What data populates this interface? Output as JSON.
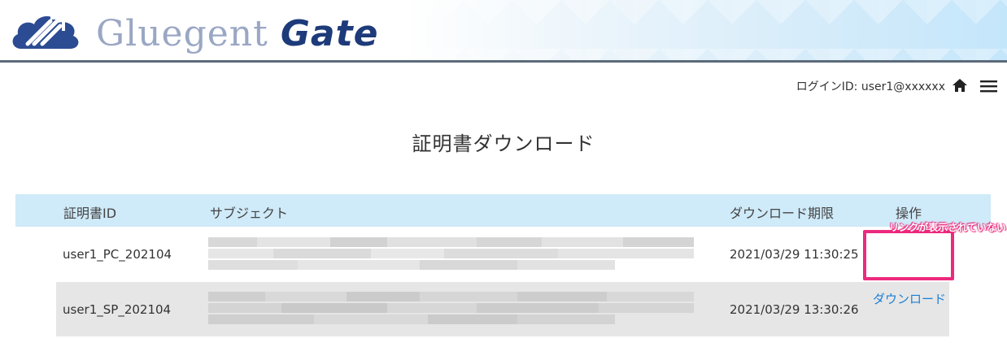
{
  "header": {
    "brand_part1": "Gluegent ",
    "brand_part2": "Gate",
    "logo_icon": "gluegent-cloud-logo-icon"
  },
  "userbar": {
    "login_text": "ログインID: user1@xxxxxx",
    "home_icon": "home-icon",
    "menu_icon": "hamburger-menu-icon"
  },
  "page": {
    "title": "証明書ダウンロード"
  },
  "table": {
    "headers": {
      "cert_id": "証明書ID",
      "subject": "サブジェクト",
      "expiry": "ダウンロード期限",
      "action": "操作"
    },
    "rows": [
      {
        "cert_id": "user1_PC_202104",
        "expiry": "2021/03/29 11:30:25",
        "action": ""
      },
      {
        "cert_id": "user1_SP_202104",
        "expiry": "2021/03/29 13:30:26",
        "action": "ダウンロード"
      }
    ]
  },
  "annotation": {
    "text": "リンクが表示されていない",
    "color": "#ec2a7d"
  },
  "colors": {
    "header_band": "#cfeaf8",
    "link": "#1a7fd4",
    "alt_row": "#e6e6e6",
    "brand_dark": "#1d3a7a"
  }
}
